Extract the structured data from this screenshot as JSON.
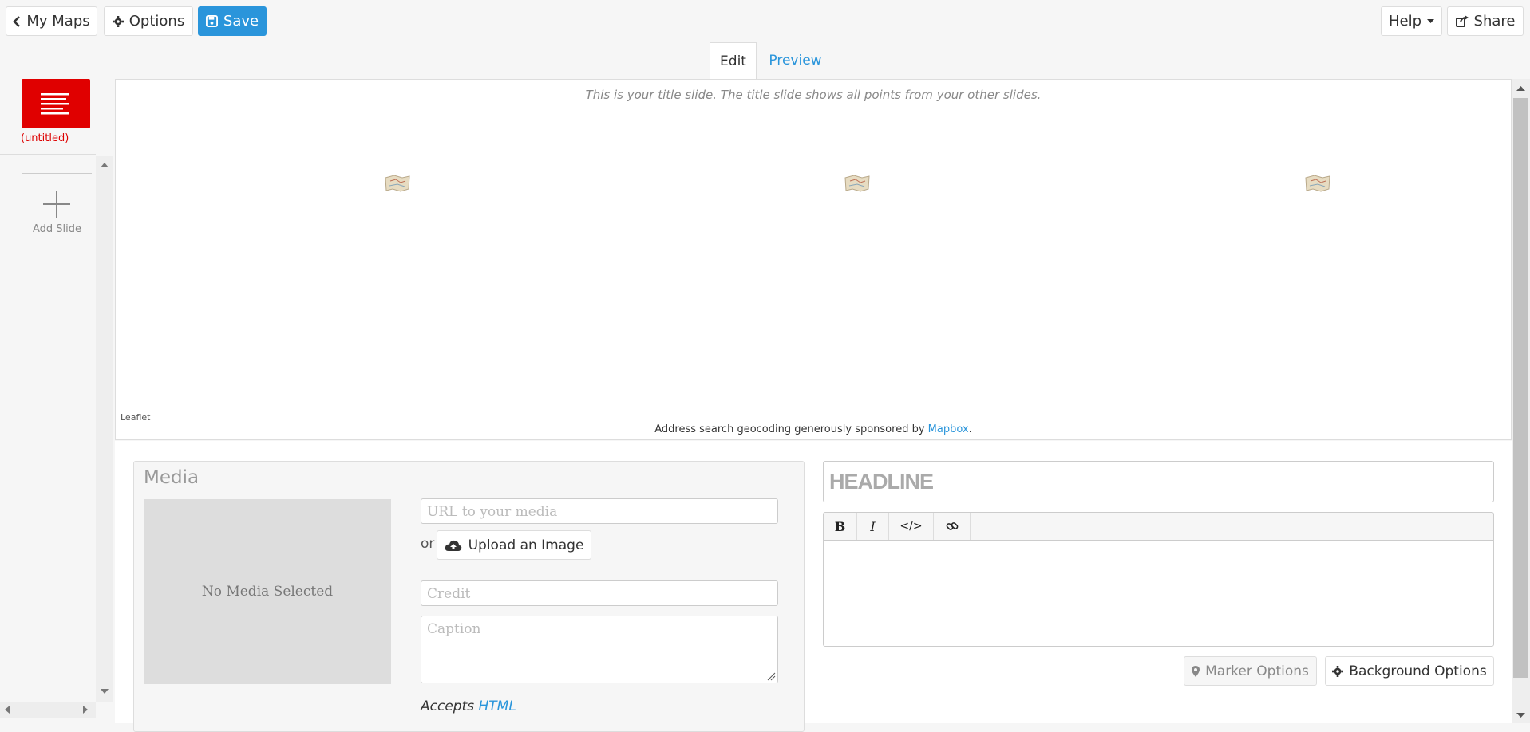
{
  "header": {
    "my_maps_label": "My Maps",
    "options_label": "Options",
    "save_label": "Save",
    "help_label": "Help",
    "share_label": "Share"
  },
  "tabs": [
    {
      "label": "Edit",
      "active": true
    },
    {
      "label": "Preview",
      "active": false
    }
  ],
  "sidebar": {
    "slides": [
      {
        "label": "(untitled)",
        "color": "#e00000"
      }
    ],
    "add_slide_label": "Add Slide"
  },
  "map": {
    "title_note": "This is your title slide. The title slide shows all points from your other slides.",
    "attribution": "Leaflet",
    "geocode_note_prefix": "Address search geocoding generously sponsored by ",
    "geocode_link": "Mapbox",
    "geocode_note_suffix": "."
  },
  "media": {
    "title": "Media",
    "no_media_text": "No Media Selected",
    "url_placeholder": "URL to your media",
    "or_label": "or",
    "upload_label": "Upload an Image",
    "credit_placeholder": "Credit",
    "caption_placeholder": "Caption",
    "accepts_prefix": "Accepts ",
    "accepts_link": "HTML"
  },
  "text_panel": {
    "headline_placeholder": "HEADLINE",
    "toolbar": [
      "B",
      "I",
      "</>",
      "link-icon"
    ],
    "marker_options_label": "Marker Options",
    "background_options_label": "Background Options"
  },
  "colors": {
    "accent": "#2a95db",
    "slide_red": "#e00000"
  }
}
